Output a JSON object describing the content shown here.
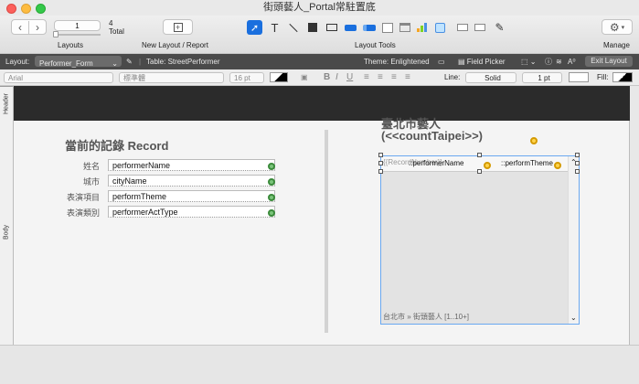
{
  "window": {
    "title": "街頭藝人_Portal常駐置底"
  },
  "toolbar": {
    "record_number": "1",
    "record_total": "4",
    "total_label": "Total",
    "layouts_label": "Layouts",
    "new_layout_label": "New Layout / Report",
    "layout_tools_label": "Layout Tools",
    "manage_label": "Manage"
  },
  "layoutbar": {
    "layout_label": "Layout:",
    "layout_name": "Performer_Form",
    "table_label": "Table: StreetPerformer",
    "theme_label": "Theme: Enlightened",
    "field_picker": "Field Picker",
    "exit_layout": "Exit Layout"
  },
  "formatbar": {
    "font": "Arial",
    "style": "標準體",
    "size": "16 pt",
    "line_label": "Line:",
    "line_style": "Solid",
    "line_width": "1 pt",
    "fill_label": "Fill:"
  },
  "parts": {
    "header": "Header",
    "body": "Body"
  },
  "record": {
    "heading": "當前的記錄 Record",
    "fields": [
      {
        "label": "姓名",
        "value": "performerName"
      },
      {
        "label": "城市",
        "value": "cityName"
      },
      {
        "label": "表演項目",
        "value": "performTheme"
      },
      {
        "label": "表演類別",
        "value": "performerActType"
      }
    ]
  },
  "portal": {
    "heading_line1": "臺北市藝人",
    "heading_line2": "(<<countTaipei>>)",
    "row_placeholder": "{{RecordNumber}}",
    "col1": "::performerName",
    "col2": "::performTheme",
    "footer": "台北市 » 街頭藝人 [1..10+]"
  },
  "colors": {
    "accent": "#1a6fde",
    "layoutbar": "#4a4a4a",
    "header": "#2b2b2b"
  }
}
